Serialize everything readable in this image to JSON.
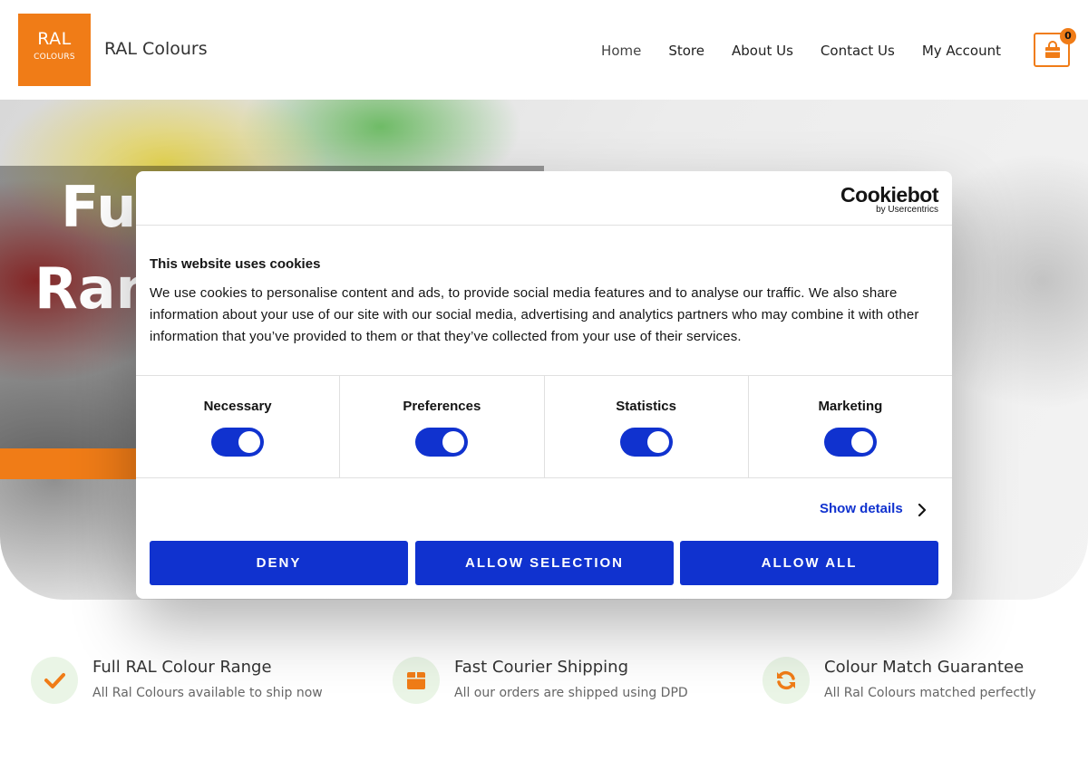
{
  "header": {
    "logo_line1": "RAL",
    "logo_line2": "COLOURS",
    "site_title": "RAL Colours",
    "nav": [
      "Home",
      "Store",
      "About Us",
      "Contact Us",
      "My Account"
    ],
    "cart_count": "0"
  },
  "hero": {
    "title_line1": "Ful",
    "title_line2": "Ran"
  },
  "features": [
    {
      "title": "Full RAL Colour Range",
      "desc": "All Ral Colours available to ship now",
      "icon": "checkmark-icon"
    },
    {
      "title": "Fast Courier Shipping",
      "desc": "All our orders are shipped using DPD",
      "icon": "box-icon"
    },
    {
      "title": "Colour Match Guarantee",
      "desc": "All Ral Colours matched perfectly",
      "icon": "refresh-icon"
    }
  ],
  "cookie": {
    "brand": "Cookiebot",
    "brand_sub": "by Usercentrics",
    "heading": "This website uses cookies",
    "body": "We use cookies to personalise content and ads, to provide social media features and to analyse our traffic. We also share information about your use of our site with our social media, advertising and analytics partners who may combine it with other information that you’ve provided to them or that they’ve collected from your use of their services.",
    "toggles": [
      {
        "label": "Necessary",
        "on": true
      },
      {
        "label": "Preferences",
        "on": true
      },
      {
        "label": "Statistics",
        "on": true
      },
      {
        "label": "Marketing",
        "on": true
      }
    ],
    "show_details": "Show details",
    "buttons": {
      "deny": "DENY",
      "allow_selection": "ALLOW SELECTION",
      "allow_all": "ALLOW ALL"
    }
  },
  "colors": {
    "brand_orange": "#f07c17",
    "cookie_blue": "#1032cf",
    "feature_icon_bg": "#eaf5e6"
  }
}
